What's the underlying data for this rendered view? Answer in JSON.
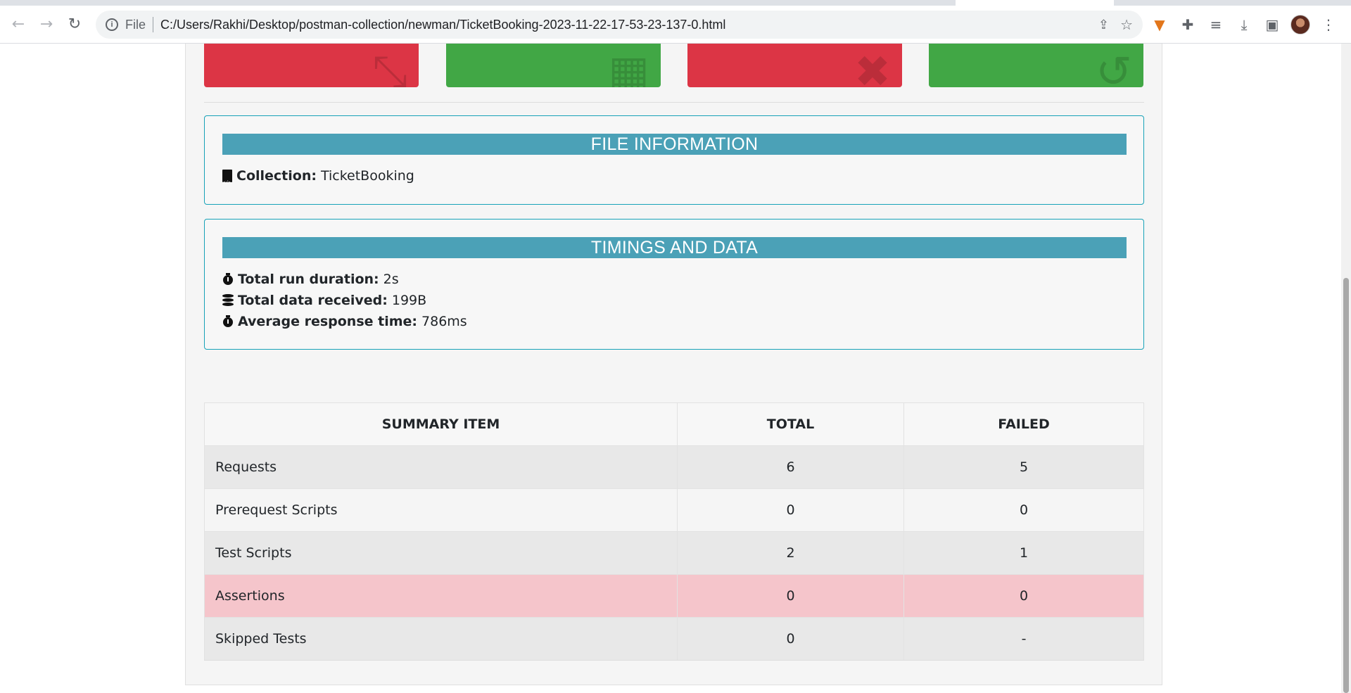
{
  "browser": {
    "scheme_label": "File",
    "url": "C:/Users/Rakhi/Desktop/postman-collection/newman/TicketBooking-2023-11-22-17-53-23-137-0.html"
  },
  "cards": [
    {
      "color": "red",
      "icon": "arrows-icon"
    },
    {
      "color": "green",
      "icon": "pattern-icon"
    },
    {
      "color": "red",
      "icon": "close-circle-icon"
    },
    {
      "color": "green",
      "icon": "refresh-icon"
    }
  ],
  "file_info": {
    "heading": "FILE INFORMATION",
    "collection_label": "Collection:",
    "collection_value": "TicketBooking"
  },
  "timings": {
    "heading": "TIMINGS AND DATA",
    "duration_label": "Total run duration:",
    "duration_value": "2s",
    "data_label": "Total data received:",
    "data_value": "199B",
    "avg_label": "Average response time:",
    "avg_value": "786ms"
  },
  "summary": {
    "headers": [
      "SUMMARY ITEM",
      "TOTAL",
      "FAILED"
    ],
    "rows": [
      {
        "item": "Requests",
        "total": "6",
        "failed": "5"
      },
      {
        "item": "Prerequest Scripts",
        "total": "0",
        "failed": "0"
      },
      {
        "item": "Test Scripts",
        "total": "2",
        "failed": "1"
      },
      {
        "item": "Assertions",
        "total": "0",
        "failed": "0"
      },
      {
        "item": "Skipped Tests",
        "total": "0",
        "failed": "-"
      }
    ]
  },
  "colors": {
    "danger": "#dc3545",
    "success": "#41a745",
    "info_band": "#4ba1b7",
    "border_info": "#17a2b8",
    "row_danger": "#f5c5cb"
  }
}
